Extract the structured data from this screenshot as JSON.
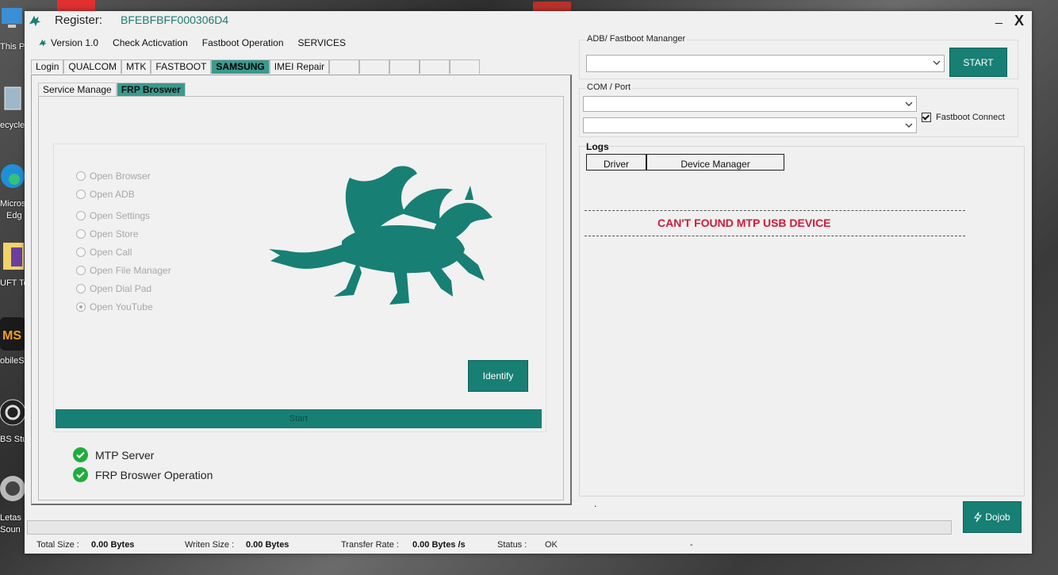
{
  "desktop": {
    "labels": [
      "This P",
      "ecycle",
      "Micros",
      "Edg",
      "UFT To",
      "obileS",
      "BS Stu",
      "Letas",
      "Soun"
    ]
  },
  "window": {
    "register_label": "Register:",
    "register_code": "BFEBFBFF000306D4",
    "minimize_label": "_",
    "close_label": "X"
  },
  "menu": {
    "version": "Version 1.0",
    "check_activation": "Check Acticvation",
    "fastboot_operation": "Fastboot Operation",
    "services": "SERVICES"
  },
  "tabs": [
    "Login",
    "QUALCOM",
    "MTK",
    "FASTBOOT",
    "SAMSUNG",
    "IMEI Repair"
  ],
  "subtabs": [
    "Service Manage",
    "FRP Broswer"
  ],
  "frp_options": [
    "Open Browser",
    "Open ADB",
    "Open Settings",
    "Open Store",
    "Open Call",
    "Open File Manager",
    "Open Dial Pad",
    "Open YouTube"
  ],
  "identify_label": "Identify",
  "start_label": "Start",
  "status_items": [
    "MTP Server",
    "FRP Broswer Operation"
  ],
  "adb": {
    "group_label": "ADB/ Fastboot Mananger",
    "start_button": "START"
  },
  "com": {
    "group_label": "COM / Port",
    "fastboot_connect": "Fastboot Connect"
  },
  "logs": {
    "label": "Logs",
    "driver_button": "Driver",
    "device_manager_button": "Device Manager",
    "message": "CAN'T FOUND MTP USB DEVICE",
    "dot": "."
  },
  "dojob_label": "Dojob",
  "statusbar": {
    "total_size_label": "Total Size :",
    "total_size_value": "0.00 Bytes",
    "writen_size_label": "Writen Size :",
    "writen_size_value": "0.00 Bytes",
    "transfer_rate_label": "Transfer Rate :",
    "transfer_rate_value": "0.00 Bytes /s",
    "status_label": "Status :",
    "status_value": "OK",
    "trailing": "-"
  },
  "colors": {
    "accent": "#177f73",
    "tab_active": "#3a9a8e",
    "error": "#d01c3c",
    "success": "#1fae3e"
  }
}
